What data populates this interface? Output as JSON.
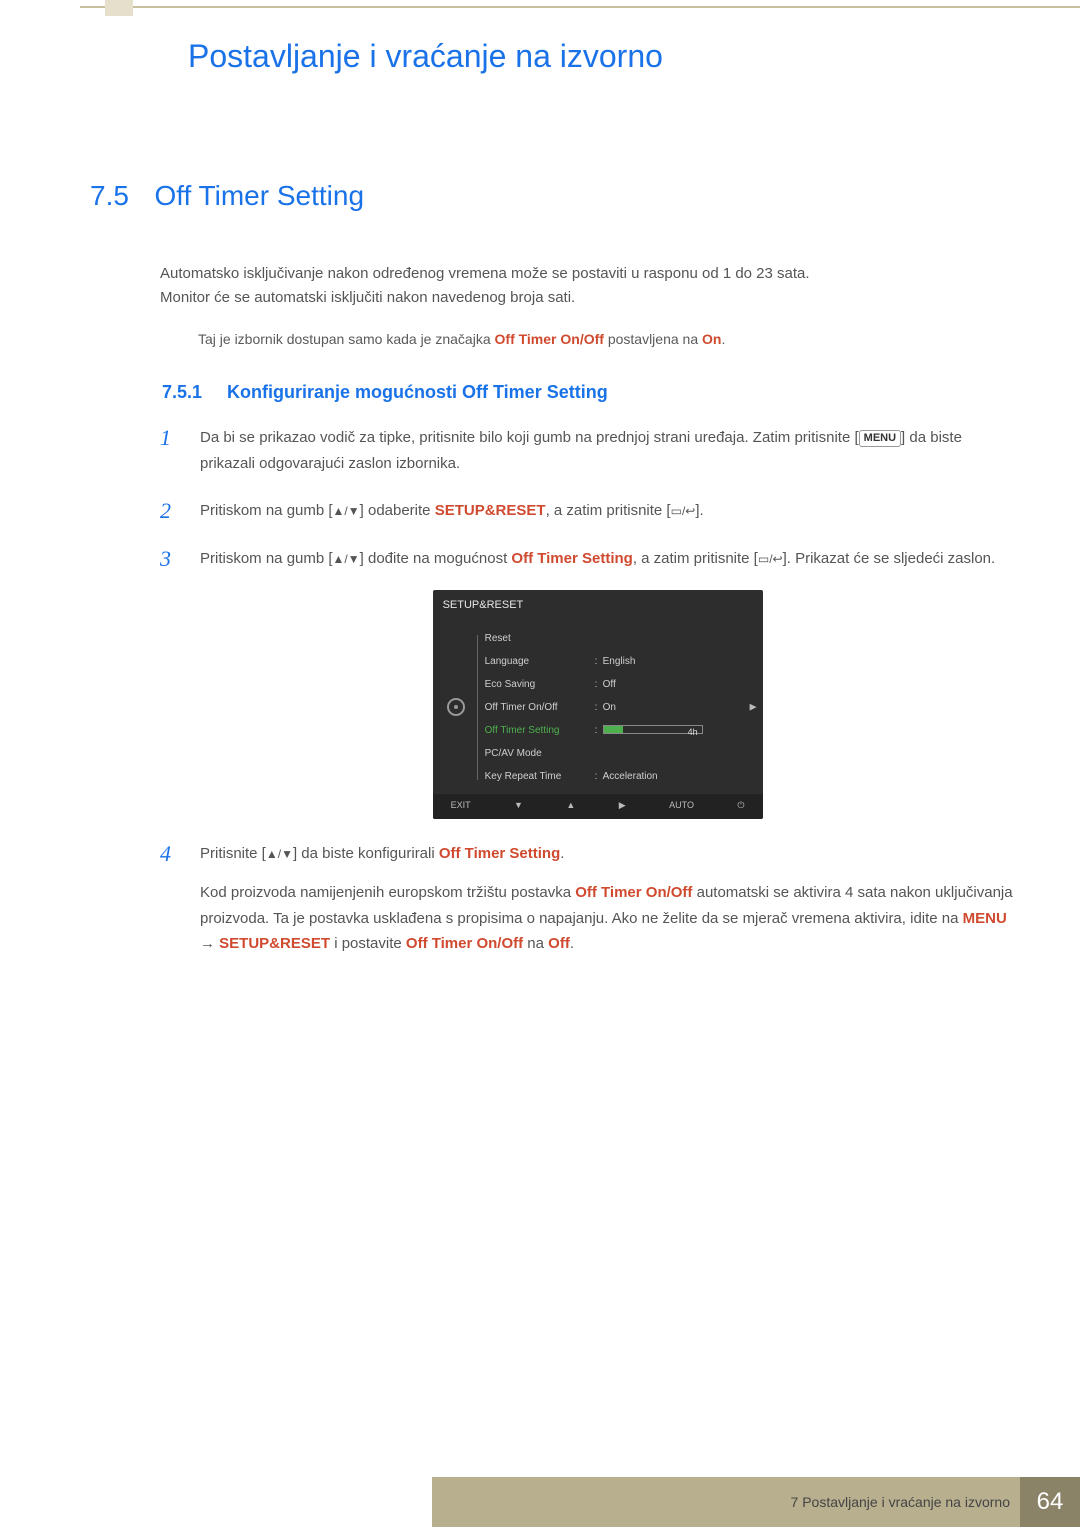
{
  "chapter_title": "Postavljanje i vraćanje na izvorno",
  "section": {
    "num": "7.5",
    "title": "Off Timer Setting"
  },
  "intro_line1": "Automatsko isključivanje nakon određenog vremena može se postaviti u rasponu od 1 do 23 sata.",
  "intro_line2": "Monitor će se automatski isključiti nakon navedenog broja sati.",
  "note": {
    "prefix": "Taj je izbornik dostupan samo kada je značajka ",
    "term": "Off Timer On/Off",
    "middle": " postavljena na ",
    "on": "On",
    "suffix": "."
  },
  "sub": {
    "num": "7.5.1",
    "title": "Konfiguriranje mogućnosti Off Timer Setting"
  },
  "steps": {
    "s1a": "Da bi se prikazao vodič za tipke, pritisnite bilo koji gumb na prednjoj strani uređaja. Zatim pritisnite ",
    "s1b": " da biste prikazali odgovarajući zaslon izbornika.",
    "menu_btn": "MENU",
    "s2a": "Pritiskom na gumb [",
    "s2b": "] odaberite ",
    "setup_reset": "SETUP&RESET",
    "s2c": ", a zatim pritisnite [",
    "s2d": "].",
    "s3a": "Pritiskom na gumb [",
    "s3b": "] dođite na mogućnost ",
    "ots": "Off Timer Setting",
    "s3c": ", a zatim pritisnite [",
    "s3d": "]. Prikazat će se sljedeći zaslon.",
    "s4a": "Pritisnite [",
    "s4b": "] da biste konfigurirali ",
    "s4c": "."
  },
  "osd": {
    "title": "SETUP&RESET",
    "rows": [
      {
        "label": "Reset",
        "value": ""
      },
      {
        "label": "Language",
        "value": "English"
      },
      {
        "label": "Eco Saving",
        "value": "Off"
      },
      {
        "label": "Off Timer On/Off",
        "value": "On"
      },
      {
        "label": "Off Timer Setting",
        "value": "4h",
        "highlight": true,
        "bar": true
      },
      {
        "label": "PC/AV Mode",
        "value": ""
      },
      {
        "label": "Key Repeat Time",
        "value": "Acceleration"
      }
    ],
    "foot": {
      "exit": "EXIT",
      "auto": "AUTO"
    }
  },
  "eu_note": {
    "a": "Kod proizvoda namijenjenih europskom tržištu postavka ",
    "term1": "Off Timer On/Off",
    "b": " automatski se aktivira 4 sata nakon uključivanja proizvoda. Ta je postavka usklađena s propisima o napajanju. Ako ne želite da se mjerač vremena aktivira, idite na ",
    "menu": "MENU",
    "arrow": " → ",
    "setup": "SETUP&RESET",
    "c": " i postavite ",
    "term2": "Off Timer On/Off",
    "d": " na ",
    "off": "Off",
    "e": "."
  },
  "footer": {
    "chapter": "7 Postavljanje i vraćanje na izvorno",
    "page": "64"
  }
}
